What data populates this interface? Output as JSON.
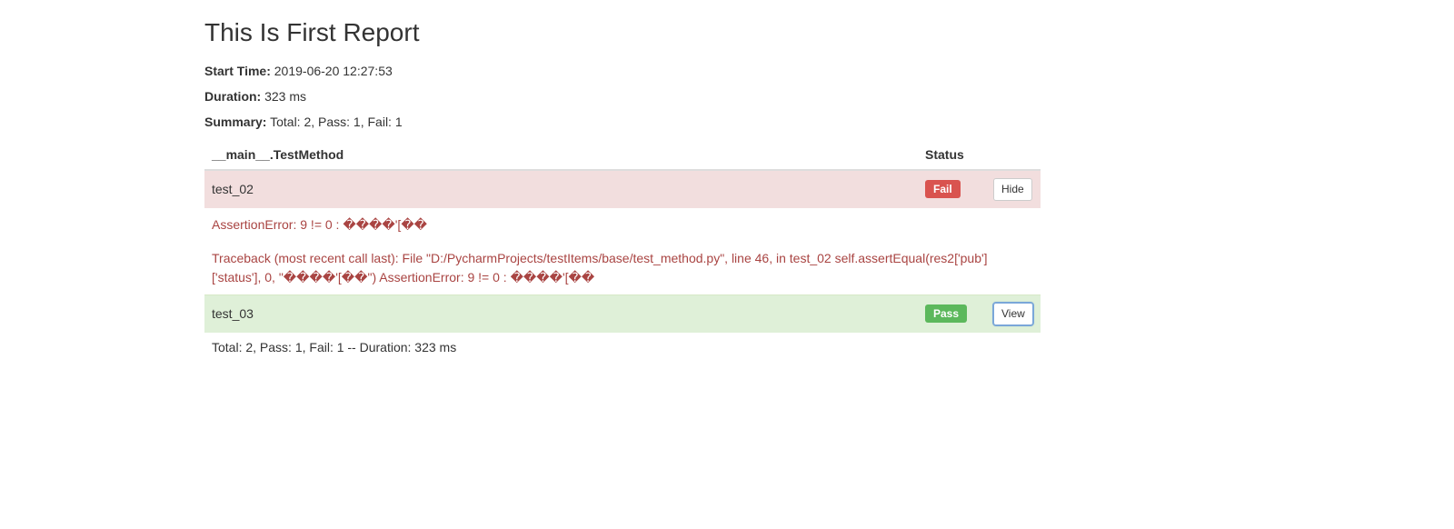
{
  "title": "This Is First Report",
  "meta": {
    "start_time_label": "Start Time:",
    "start_time_value": "2019-06-20 12:27:53",
    "duration_label": "Duration:",
    "duration_value": "323 ms",
    "summary_label": "Summary:",
    "summary_value": "Total: 2, Pass: 1, Fail: 1"
  },
  "table": {
    "header_name": "__main__.TestMethod",
    "header_status": "Status",
    "rows": [
      {
        "name": "test_02",
        "status": "Fail",
        "button": "Hide",
        "assertion": "AssertionError: 9 != 0 : ����'[��",
        "traceback": "Traceback (most recent call last): File \"D:/PycharmProjects/testItems/base/test_method.py\", line 46, in test_02 self.assertEqual(res2['pub']['status'], 0, \"����'[��\") AssertionError: 9 != 0 : ����'[��"
      },
      {
        "name": "test_03",
        "status": "Pass",
        "button": "View"
      }
    ]
  },
  "footer": "Total: 2, Pass: 1, Fail: 1 -- Duration: 323 ms"
}
